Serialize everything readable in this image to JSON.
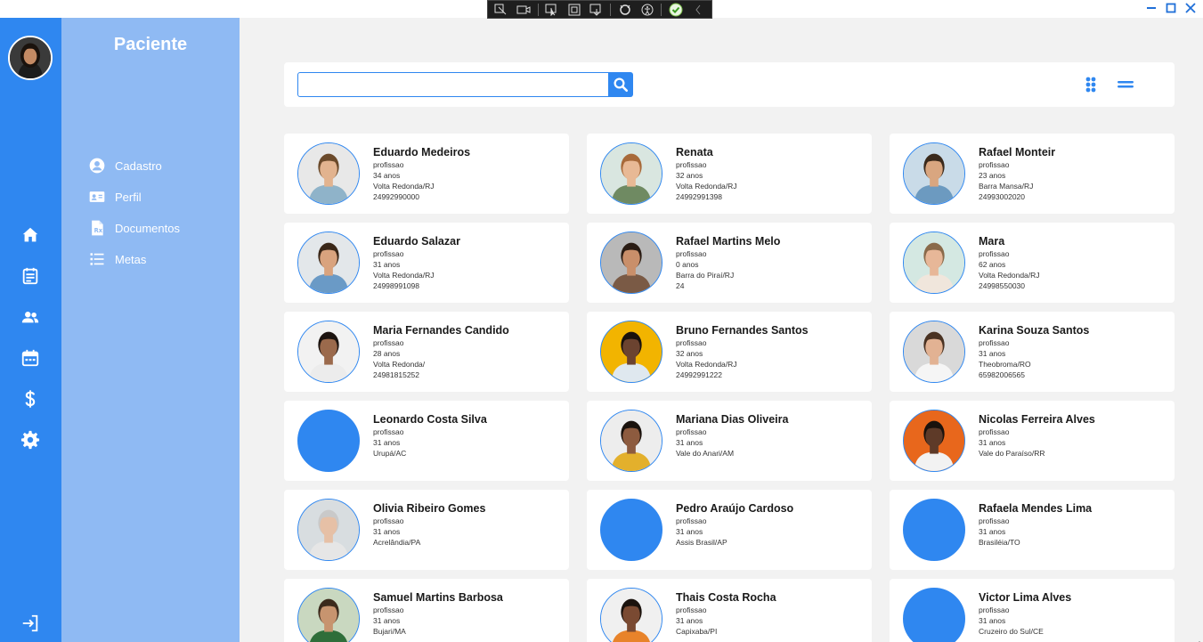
{
  "window": {
    "controls": [
      "minimize",
      "maximize",
      "close"
    ],
    "accent_color": "#2f87f0"
  },
  "rail": {
    "icons": [
      "home-icon",
      "notes-icon",
      "group-icon",
      "calendar-icon",
      "dollar-icon",
      "gear-icon",
      "logout-icon"
    ]
  },
  "sidebar": {
    "title": "Paciente",
    "items": [
      {
        "label": "Cadastro",
        "icon": "account-circle-icon"
      },
      {
        "label": "Perfil",
        "icon": "id-card-icon"
      },
      {
        "label": "Documentos",
        "icon": "document-icon"
      },
      {
        "label": "Metas",
        "icon": "list-icon"
      }
    ]
  },
  "search": {
    "value": "",
    "placeholder": ""
  },
  "patients": [
    {
      "name": "Eduardo Medeiros",
      "role": "profissao",
      "age": "34 anos",
      "city": "Volta Redonda/RJ",
      "phone": "24992990000",
      "photo": "photo",
      "bg": "#e8e8e8",
      "skin": "#e2b38f",
      "hair": "#6b4a2b",
      "shirt": "#8fb3c9"
    },
    {
      "name": "Renata",
      "role": "profissao",
      "age": "32 anos",
      "city": "Volta Redonda/RJ",
      "phone": "24992991398",
      "photo": "photo",
      "bg": "#d9e6e0",
      "skin": "#e8b995",
      "hair": "#a86a3a",
      "shirt": "#6f8a62"
    },
    {
      "name": "Rafael Monteir",
      "role": "profissao",
      "age": "23 anos",
      "city": "Barra Mansa/RJ",
      "phone": "24993002020",
      "photo": "photo",
      "bg": "#c9dbe8",
      "skin": "#d9a680",
      "hair": "#3b2a1c",
      "shirt": "#6c9ac0"
    },
    {
      "name": "Eduardo Salazar",
      "role": "profissao",
      "age": "31 anos",
      "city": "Volta Redonda/RJ",
      "phone": "24998991098",
      "photo": "photo",
      "bg": "#e3e7ea",
      "skin": "#d9a37e",
      "hair": "#3a2718",
      "shirt": "#6a9ac6"
    },
    {
      "name": "Rafael Martins Melo",
      "role": "profissao",
      "age": "0 anos",
      "city": "Barra do Piraí/RJ",
      "phone": "24",
      "photo": "photo",
      "bg": "#b9b9b9",
      "skin": "#c98f6a",
      "hair": "#2b1d14",
      "shirt": "#7a5a45"
    },
    {
      "name": "Mara",
      "role": "profissao",
      "age": "62 anos",
      "city": "Volta Redonda/RJ",
      "phone": "24998550030",
      "photo": "photo",
      "bg": "#d4e8e2",
      "skin": "#e7b798",
      "hair": "#8a6a4a",
      "shirt": "#f0e6dc"
    },
    {
      "name": "Maria Fernandes Candido",
      "role": "profissao",
      "age": "28 anos",
      "city": "Volta Redonda/",
      "phone": "24981815252",
      "photo": "photo",
      "bg": "#f2f2f2",
      "skin": "#9b6a4c",
      "hair": "#1c1410",
      "shirt": "#ececec"
    },
    {
      "name": "Bruno Fernandes Santos",
      "role": "profissao",
      "age": "32 anos",
      "city": "Volta Redonda/RJ",
      "phone": "24992991222",
      "photo": "photo",
      "bg": "#f2b400",
      "skin": "#6b4330",
      "hair": "#1a120d",
      "shirt": "#dfe8ef"
    },
    {
      "name": "Karina Souza Santos",
      "role": "profissao",
      "age": "31 anos",
      "city": "Theobroma/RO",
      "phone": "65982006565",
      "photo": "photo",
      "bg": "#d9d9d9",
      "skin": "#e2b293",
      "hair": "#4a3222",
      "shirt": "#f5f5f5"
    },
    {
      "name": "Leonardo Costa Silva",
      "role": "profissao",
      "age": "31 anos",
      "city": "Urupá/AC",
      "phone": "",
      "photo": "none",
      "bg": "#2f87f0",
      "skin": "",
      "hair": "",
      "shirt": ""
    },
    {
      "name": "Mariana Dias Oliveira",
      "role": "profissao",
      "age": "31 anos",
      "city": "Vale do Anari/AM",
      "phone": "",
      "photo": "photo",
      "bg": "#ededed",
      "skin": "#8d5b3f",
      "hair": "#1a120d",
      "shirt": "#e3b02c"
    },
    {
      "name": "Nicolas Ferreira Alves",
      "role": "profissao",
      "age": "31 anos",
      "city": "Vale do Paraíso/RR",
      "phone": "",
      "photo": "photo",
      "bg": "#e8671c",
      "skin": "#5e3a28",
      "hair": "#1a120d",
      "shirt": "#f2f2f2"
    },
    {
      "name": "Olivia Ribeiro Gomes",
      "role": "profissao",
      "age": "31 anos",
      "city": "Acrelândia/PA",
      "phone": "",
      "photo": "photo",
      "bg": "#d8dde0",
      "skin": "#e6c0a6",
      "hair": "#c9c9c9",
      "shirt": "#e6e6e6"
    },
    {
      "name": "Pedro Araújo Cardoso",
      "role": "profissao",
      "age": "31 anos",
      "city": "Assis Brasil/AP",
      "phone": "",
      "photo": "none",
      "bg": "#2f87f0",
      "skin": "",
      "hair": "",
      "shirt": ""
    },
    {
      "name": "Rafaela Mendes Lima",
      "role": "profissao",
      "age": "31 anos",
      "city": "Brasiléia/TO",
      "phone": "",
      "photo": "none",
      "bg": "#2f87f0",
      "skin": "",
      "hair": "",
      "shirt": ""
    },
    {
      "name": "Samuel Martins Barbosa",
      "role": "profissao",
      "age": "31 anos",
      "city": "Bujari/MA",
      "phone": "",
      "photo": "photo",
      "bg": "#c9d8c0",
      "skin": "#c7946f",
      "hair": "#3b2a1c",
      "shirt": "#2f6e3a"
    },
    {
      "name": "Thais Costa Rocha",
      "role": "profissao",
      "age": "31 anos",
      "city": "Capixaba/PI",
      "phone": "",
      "photo": "photo",
      "bg": "#f0f0f0",
      "skin": "#7a4a32",
      "hair": "#1a120d",
      "shirt": "#e8832a"
    },
    {
      "name": "Victor Lima Alves",
      "role": "profissao",
      "age": "31 anos",
      "city": "Cruzeiro do Sul/CE",
      "phone": "",
      "photo": "none",
      "bg": "#2f87f0",
      "skin": "",
      "hair": "",
      "shirt": ""
    }
  ]
}
